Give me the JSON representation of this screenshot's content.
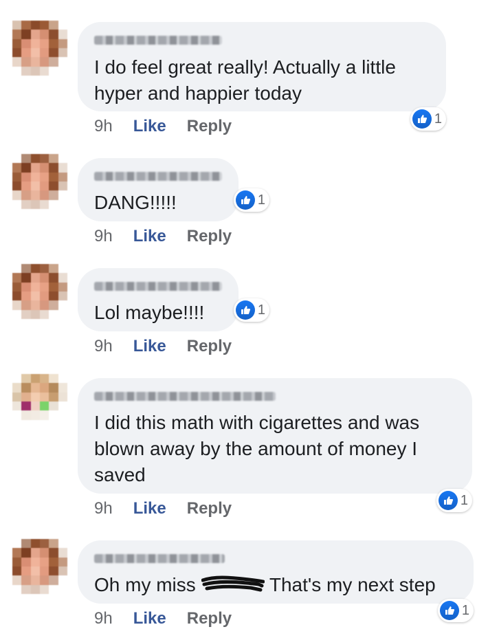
{
  "comments": [
    {
      "text": "I do feel great really! Actually a little\nhyper and happier today",
      "time": "9h",
      "like_label": "Like",
      "reply_label": "Reply",
      "reaction_count": "1"
    },
    {
      "text": "DANG!!!!!",
      "time": "9h",
      "like_label": "Like",
      "reply_label": "Reply",
      "reaction_count": "1"
    },
    {
      "text": "Lol maybe!!!!",
      "time": "9h",
      "like_label": "Like",
      "reply_label": "Reply",
      "reaction_count": "1"
    },
    {
      "text": "I did this math with cigarettes and was\nblown away by the amount of money I\nsaved",
      "time": "9h",
      "like_label": "Like",
      "reply_label": "Reply",
      "reaction_count": "1"
    },
    {
      "text_before": "Oh my miss",
      "text_after": "That's my next step",
      "time": "9h",
      "like_label": "Like",
      "reply_label": "Reply",
      "reaction_count": "1"
    }
  ],
  "icons": {
    "reaction": "thumbs-up-icon",
    "avatar": "blurred-avatar"
  },
  "colors": {
    "bubble": "#f0f2f5",
    "like_link": "#385898",
    "reaction_blue": "#1877f2"
  }
}
